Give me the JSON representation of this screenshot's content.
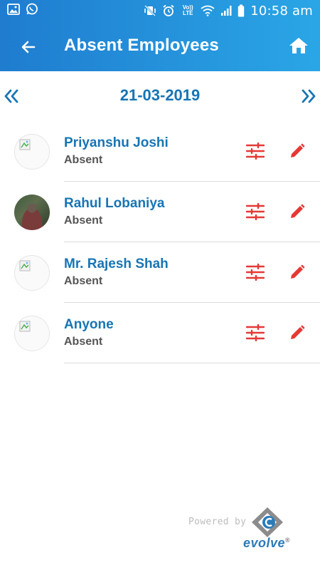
{
  "status_bar": {
    "left_icons": [
      "image-icon",
      "whatsapp-icon"
    ],
    "right_icons": [
      "mute-vibrate-icon",
      "alarm-icon",
      "volte-icon",
      "wifi-icon",
      "signal-icon",
      "battery-icon"
    ],
    "volte_text": "Vo)) LTE",
    "time": "10:58 am"
  },
  "app_bar": {
    "title": "Absent Employees",
    "back_icon": "arrow-left-icon",
    "home_icon": "home-icon"
  },
  "date_nav": {
    "date": "21-03-2019",
    "prev_icon": "chevrons-left-icon",
    "next_icon": "chevrons-right-icon"
  },
  "employees": [
    {
      "name": "Priyanshu Joshi",
      "status": "Absent",
      "avatar": "broken-image"
    },
    {
      "name": "Rahul Lobaniya",
      "status": "Absent",
      "avatar": "photo"
    },
    {
      "name": "Mr. Rajesh Shah",
      "status": "Absent",
      "avatar": "broken-image"
    },
    {
      "name": "Anyone",
      "status": "Absent",
      "avatar": "broken-image"
    }
  ],
  "row_actions": {
    "filter_icon": "sliders-icon",
    "edit_icon": "pencil-icon"
  },
  "footer": {
    "powered_by": "Powered by",
    "brand": "evolve",
    "registered": "®"
  },
  "colors": {
    "header_start": "#1f7ccf",
    "header_end": "#2aa6e6",
    "accent_blue": "#1775b4",
    "action_red": "#e53935",
    "status_gray": "#555555"
  }
}
